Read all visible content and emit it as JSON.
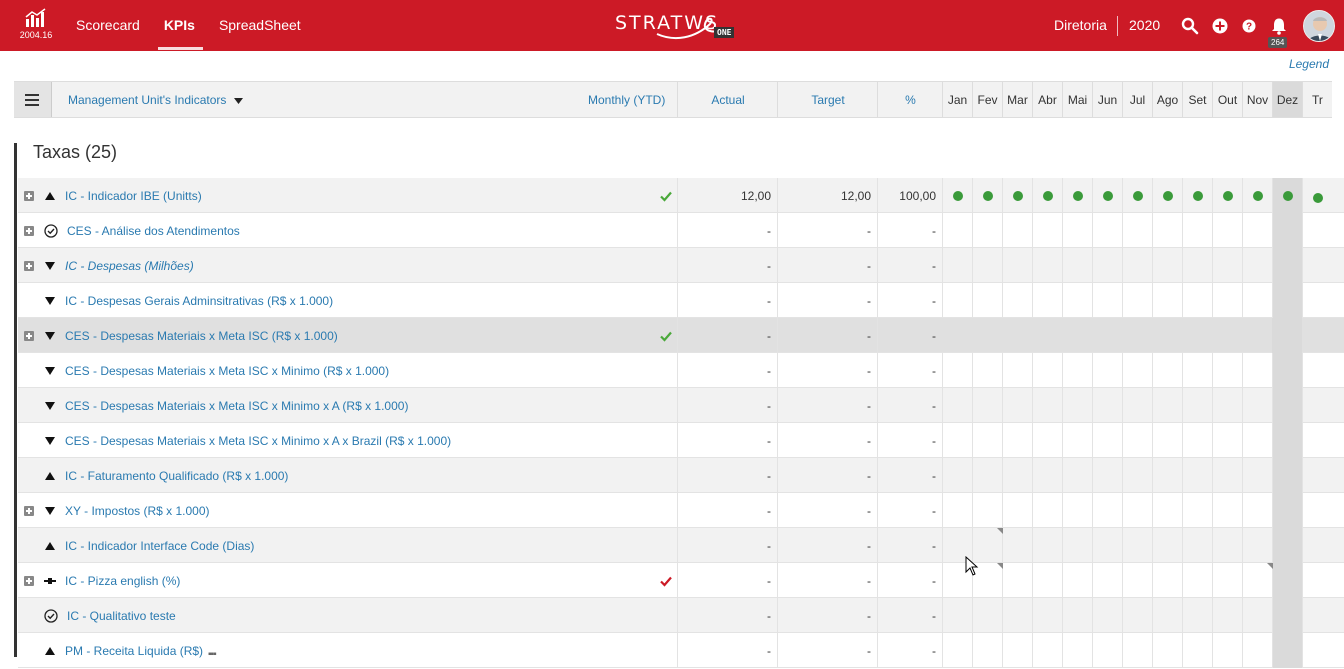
{
  "app": {
    "version": "2004.16",
    "brand": "STRATWS",
    "brand_badge": "ONE",
    "nav": [
      "Scorecard",
      "KPIs",
      "SpreadSheet"
    ],
    "active_nav": "KPIs",
    "context": "Diretoria",
    "year": "2020",
    "notifications": "264",
    "accent_color": "#cc1a26"
  },
  "legend_link": "Legend",
  "table_header": {
    "indicators_select": "Management Unit's Indicators",
    "period": "Monthly (YTD)",
    "actual": "Actual",
    "target": "Target",
    "percent": "%",
    "months": [
      "Jan",
      "Fev",
      "Mar",
      "Abr",
      "Mai",
      "Jun",
      "Jul",
      "Ago",
      "Set",
      "Out",
      "Nov",
      "Dez",
      "Tr"
    ]
  },
  "section": {
    "title": "Taxas (25)"
  },
  "rows": [
    {
      "name": "IC - Indicador IBE (Unitts)",
      "expand": true,
      "dir": "up",
      "status": "check-green",
      "actual": "12,00",
      "target": "12,00",
      "pct": "100,00",
      "dots": true
    },
    {
      "name": "CES - Análise dos Atendimentos",
      "expand": true,
      "dir": "circle-check",
      "status": "",
      "actual": "-",
      "target": "-",
      "pct": "-"
    },
    {
      "name": "IC - Despesas (Milhões)",
      "expand": true,
      "dir": "down",
      "status": "",
      "actual": "-",
      "target": "-",
      "pct": "-",
      "italic": true
    },
    {
      "name": "IC - Despesas Gerais Adminsitrativas (R$ x 1.000)",
      "expand": false,
      "dir": "down",
      "status": "",
      "actual": "-",
      "target": "-",
      "pct": "-"
    },
    {
      "name": "CES - Despesas Materiais x Meta ISC (R$ x 1.000)",
      "expand": true,
      "dir": "down",
      "status": "check-green",
      "actual": "-",
      "target": "-",
      "pct": "-",
      "highlight": true
    },
    {
      "name": "CES - Despesas Materiais x Meta ISC x Minimo (R$ x 1.000)",
      "expand": false,
      "dir": "down",
      "status": "",
      "actual": "-",
      "target": "-",
      "pct": "-"
    },
    {
      "name": "CES - Despesas Materiais x Meta ISC x Minimo x A (R$ x 1.000)",
      "expand": false,
      "dir": "down",
      "status": "",
      "actual": "-",
      "target": "-",
      "pct": "-"
    },
    {
      "name": "CES - Despesas Materiais x Meta ISC x Minimo x A x Brazil (R$ x 1.000)",
      "expand": false,
      "dir": "down",
      "status": "",
      "actual": "-",
      "target": "-",
      "pct": "-"
    },
    {
      "name": "IC - Faturamento Qualificado (R$ x 1.000)",
      "expand": false,
      "dir": "up",
      "status": "",
      "actual": "-",
      "target": "-",
      "pct": "-"
    },
    {
      "name": "XY - Impostos (R$ x 1.000)",
      "expand": true,
      "dir": "down",
      "status": "",
      "actual": "-",
      "target": "-",
      "pct": "-"
    },
    {
      "name": "IC - Indicador Interface Code (Dias)",
      "expand": false,
      "dir": "up",
      "status": "",
      "actual": "-",
      "target": "-",
      "pct": "-"
    },
    {
      "name": "IC - Pizza english (%)",
      "expand": true,
      "dir": "flat",
      "status": "check-red",
      "actual": "-",
      "target": "-",
      "pct": "-"
    },
    {
      "name": "IC - Qualitativo teste",
      "expand": false,
      "dir": "circle-check",
      "status": "",
      "actual": "-",
      "target": "-",
      "pct": "-"
    },
    {
      "name": "PM - Receita Liquida (R$)",
      "expand": false,
      "dir": "up",
      "status": "",
      "actual": "-",
      "target": "-",
      "pct": "-",
      "more": "▪▪▪"
    }
  ]
}
